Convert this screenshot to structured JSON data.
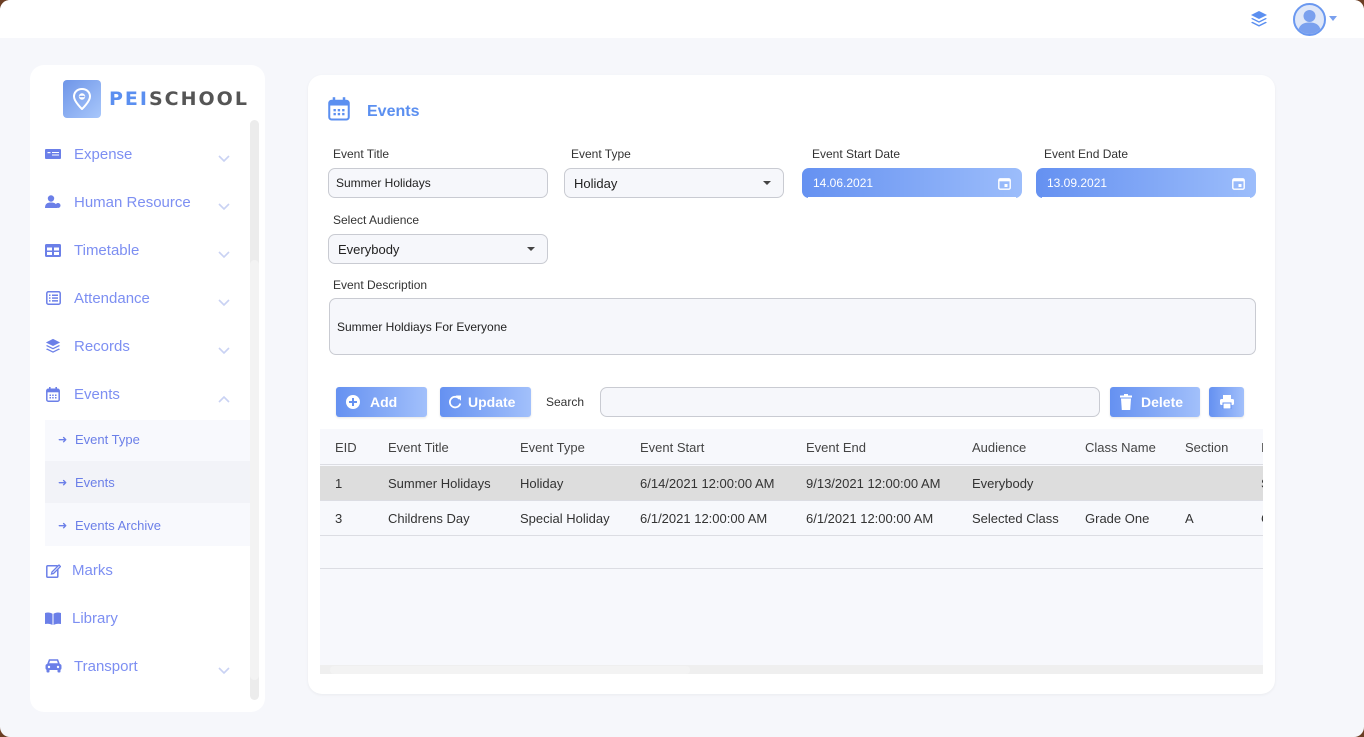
{
  "topbar": {
    "layers_icon": "layers-icon",
    "avatar_icon": "user-avatar-icon"
  },
  "brand": {
    "prefix": "PEI",
    "suffix": "SCHOOL"
  },
  "sidebar": {
    "items": [
      {
        "label": "Expense",
        "icon": "money-bill-icon",
        "expandable": true
      },
      {
        "label": "Human Resource",
        "icon": "user-tie-icon",
        "expandable": true
      },
      {
        "label": "Timetable",
        "icon": "table-icon",
        "expandable": true
      },
      {
        "label": "Attendance",
        "icon": "list-icon",
        "expandable": true
      },
      {
        "label": "Records",
        "icon": "layers-icon",
        "expandable": true
      },
      {
        "label": "Events",
        "icon": "calendar-icon",
        "expandable": true,
        "expanded": true
      },
      {
        "label": "Marks",
        "icon": "edit-icon",
        "expandable": false
      },
      {
        "label": "Library",
        "icon": "book-icon",
        "expandable": false
      },
      {
        "label": "Transport",
        "icon": "car-icon",
        "expandable": true
      }
    ],
    "events_submenu": [
      {
        "label": "Event Type",
        "active": false
      },
      {
        "label": "Events",
        "active": true
      },
      {
        "label": "Events Archive",
        "active": false
      }
    ]
  },
  "page": {
    "title": "Events",
    "form": {
      "event_title_label": "Event Title",
      "event_title_value": "Summer Holidays",
      "event_type_label": "Event Type",
      "event_type_value": "Holiday",
      "start_date_label": "Event Start Date",
      "start_date_value": "14.06.2021",
      "end_date_label": "Event End Date",
      "end_date_value": "13.09.2021",
      "audience_label": "Select Audience",
      "audience_value": "Everybody",
      "description_label": "Event Description",
      "description_value": "Summer Holdiays For Everyone"
    },
    "toolbar": {
      "add_label": "Add",
      "update_label": "Update",
      "search_label": "Search",
      "search_value": "",
      "delete_label": "Delete",
      "print_icon": "print-icon"
    },
    "table": {
      "columns": [
        "EID",
        "Event Title",
        "Event Type",
        "Event Start",
        "Event End",
        "Audience",
        "Class Name",
        "Section",
        "I"
      ],
      "rows": [
        [
          "1",
          "Summer Holidays",
          "Holiday",
          "6/14/2021 12:00:00 AM",
          "9/13/2021 12:00:00 AM",
          "Everybody",
          "",
          "",
          "S"
        ],
        [
          "3",
          "Childrens Day",
          "Special Holiday",
          "6/1/2021 12:00:00 AM",
          "6/1/2021 12:00:00 AM",
          "Selected Class",
          "Grade One",
          "A",
          "C"
        ]
      ],
      "selected_row": 0
    }
  },
  "colors": {
    "accent": "#5b8ff0",
    "nav_text": "#7d8ff2",
    "gradient_start": "#6591f1",
    "gradient_end": "#a2c0fb",
    "selected_row": "#dddddd",
    "background": "#f6f7fb"
  }
}
